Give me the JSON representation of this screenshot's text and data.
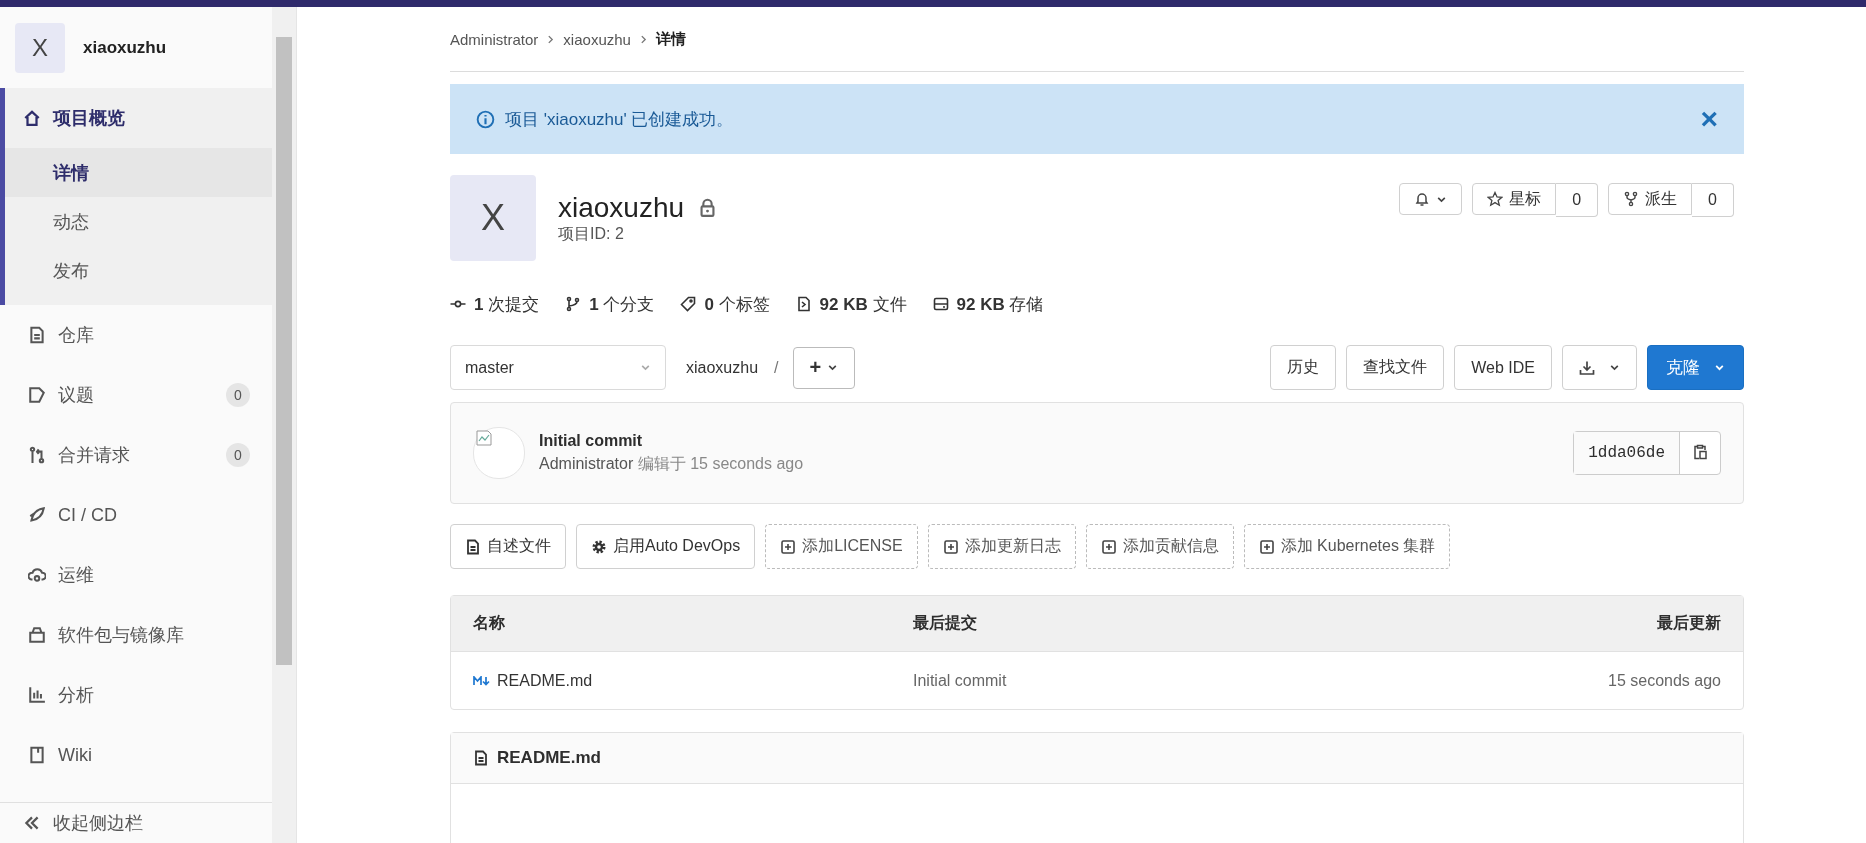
{
  "sidebar": {
    "project": {
      "avatar": "X",
      "name": "xiaoxuzhu"
    },
    "items": [
      {
        "kind": "home",
        "label": "项目概览",
        "selected": true,
        "children": [
          {
            "label": "详情",
            "selected": true
          },
          {
            "label": "动态",
            "selected": false
          },
          {
            "label": "发布",
            "selected": false
          }
        ]
      },
      {
        "kind": "file",
        "label": "仓库",
        "selected": false
      },
      {
        "kind": "issue",
        "label": "议题",
        "selected": false,
        "count": "0"
      },
      {
        "kind": "merge",
        "label": "合并请求",
        "selected": false,
        "count": "0"
      },
      {
        "kind": "rocket",
        "label": "CI / CD",
        "selected": false
      },
      {
        "kind": "cloud",
        "label": "运维",
        "selected": false
      },
      {
        "kind": "package",
        "label": "软件包与镜像库",
        "selected": false
      },
      {
        "kind": "chart",
        "label": "分析",
        "selected": false
      },
      {
        "kind": "book",
        "label": "Wiki",
        "selected": false
      }
    ],
    "collapse": "收起侧边栏"
  },
  "breadcrumb": [
    "Administrator",
    "xiaoxuzhu",
    "详情"
  ],
  "alert": {
    "message": "项目 'xiaoxuzhu' 已创建成功。",
    "close": "×"
  },
  "project": {
    "avatar": "X",
    "name": "xiaoxuzhu",
    "id": "项目ID: 2",
    "star": {
      "label": "星标",
      "count": "0"
    },
    "fork": {
      "label": "派生",
      "count": "0"
    }
  },
  "stats": [
    {
      "kind": "commit",
      "value": "1",
      "label": "次提交"
    },
    {
      "kind": "branch",
      "value": "1",
      "label": "个分支"
    },
    {
      "kind": "tag",
      "value": "0",
      "label": "个标签"
    },
    {
      "kind": "files",
      "value": "92 KB",
      "label": "文件"
    },
    {
      "kind": "storage",
      "value": "92 KB",
      "label": "存储"
    }
  ],
  "toolbar": {
    "branch": "master",
    "path": "xiaoxuzhu",
    "separator": "/",
    "add": "+",
    "buttons": [
      "历史",
      "查找文件",
      "Web IDE"
    ],
    "clone": "克隆"
  },
  "commit": {
    "title": "Initial commit",
    "author": "Administrator",
    "action": "编辑于",
    "time": "15 seconds ago",
    "sha": "1dda06de"
  },
  "actions": [
    {
      "kind": "file",
      "label": "自述文件",
      "dashed": false
    },
    {
      "kind": "gear",
      "label": "启用Auto DevOps",
      "dashed": false
    },
    {
      "kind": "plus",
      "label": "添加LICENSE",
      "dashed": true
    },
    {
      "kind": "plus",
      "label": "添加更新日志",
      "dashed": true
    },
    {
      "kind": "plus",
      "label": "添加贡献信息",
      "dashed": true
    },
    {
      "kind": "plus",
      "label": "添加 Kubernetes 集群",
      "dashed": true
    }
  ],
  "table": {
    "columns": [
      "名称",
      "最后提交",
      "最后更新"
    ],
    "rows": [
      {
        "name": "README.md",
        "commit": "Initial commit",
        "updated": "15 seconds ago"
      }
    ]
  },
  "readme": {
    "title": "README.md"
  }
}
